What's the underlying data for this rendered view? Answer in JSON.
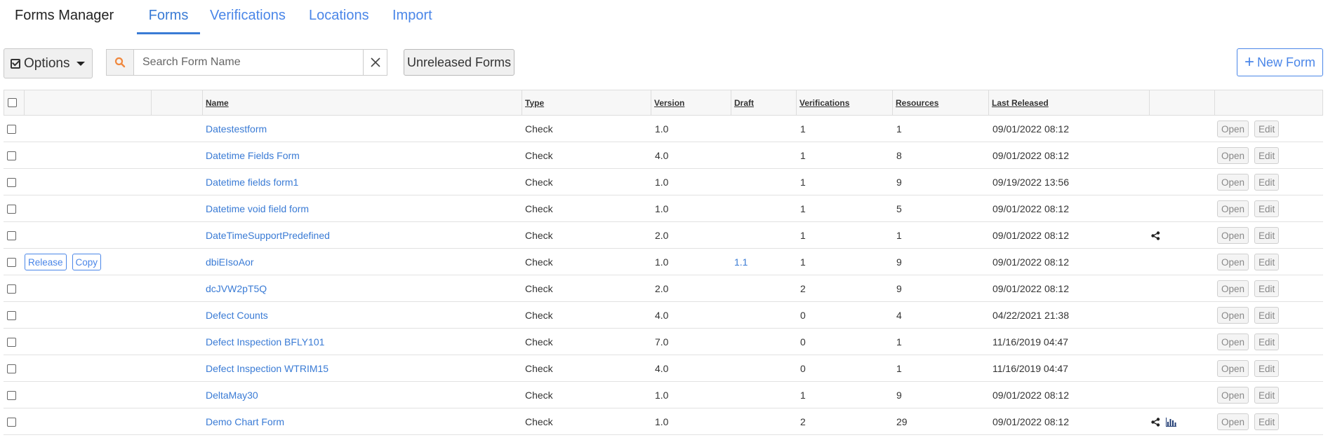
{
  "app": {
    "title": "Forms Manager"
  },
  "tabs": [
    {
      "label": "Forms",
      "active": true
    },
    {
      "label": "Verifications",
      "active": false
    },
    {
      "label": "Locations",
      "active": false
    },
    {
      "label": "Import",
      "active": false
    }
  ],
  "toolbar": {
    "options_label": "Options",
    "search_placeholder": "Search Form Name",
    "search_value": "",
    "unreleased_label": "Unreleased Forms",
    "new_form_label": "New Form"
  },
  "colors": {
    "accent": "#3a7bd5",
    "search_icon": "#f0883e"
  },
  "table": {
    "columns": [
      "Name",
      "Type",
      "Version",
      "Draft",
      "Verifications",
      "Resources",
      "Last Released"
    ],
    "rows": [
      {
        "name": "Datestestform",
        "type": "Check",
        "version": "1.0",
        "draft": "",
        "verifications": "1",
        "resources": "1",
        "last_released": "09/01/2022 08:12",
        "actions": [],
        "icons": [],
        "open": "Open",
        "edit": "Edit"
      },
      {
        "name": "Datetime Fields Form",
        "type": "Check",
        "version": "4.0",
        "draft": "",
        "verifications": "1",
        "resources": "8",
        "last_released": "09/01/2022 08:12",
        "actions": [],
        "icons": [],
        "open": "Open",
        "edit": "Edit"
      },
      {
        "name": "Datetime fields form1",
        "type": "Check",
        "version": "1.0",
        "draft": "",
        "verifications": "1",
        "resources": "9",
        "last_released": "09/19/2022 13:56",
        "actions": [],
        "icons": [],
        "open": "Open",
        "edit": "Edit"
      },
      {
        "name": "Datetime void field form",
        "type": "Check",
        "version": "1.0",
        "draft": "",
        "verifications": "1",
        "resources": "5",
        "last_released": "09/01/2022 08:12",
        "actions": [],
        "icons": [],
        "open": "Open",
        "edit": "Edit"
      },
      {
        "name": "DateTimeSupportPredefined",
        "type": "Check",
        "version": "2.0",
        "draft": "",
        "verifications": "1",
        "resources": "1",
        "last_released": "09/01/2022 08:12",
        "actions": [],
        "icons": [
          "share-icon"
        ],
        "open": "Open",
        "edit": "Edit"
      },
      {
        "name": "dbiEIsoAor",
        "type": "Check",
        "version": "1.0",
        "draft": "1.1",
        "verifications": "1",
        "resources": "9",
        "last_released": "09/01/2022 08:12",
        "actions": [
          "Release",
          "Copy"
        ],
        "icons": [],
        "open": "Open",
        "edit": "Edit"
      },
      {
        "name": "dcJVW2pT5Q",
        "type": "Check",
        "version": "2.0",
        "draft": "",
        "verifications": "2",
        "resources": "9",
        "last_released": "09/01/2022 08:12",
        "actions": [],
        "icons": [],
        "open": "Open",
        "edit": "Edit"
      },
      {
        "name": "Defect Counts",
        "type": "Check",
        "version": "4.0",
        "draft": "",
        "verifications": "0",
        "resources": "4",
        "last_released": "04/22/2021 21:38",
        "actions": [],
        "icons": [],
        "open": "Open",
        "edit": "Edit"
      },
      {
        "name": "Defect Inspection BFLY101",
        "type": "Check",
        "version": "7.0",
        "draft": "",
        "verifications": "0",
        "resources": "1",
        "last_released": "11/16/2019 04:47",
        "actions": [],
        "icons": [],
        "open": "Open",
        "edit": "Edit"
      },
      {
        "name": "Defect Inspection WTRIM15",
        "type": "Check",
        "version": "4.0",
        "draft": "",
        "verifications": "0",
        "resources": "1",
        "last_released": "11/16/2019 04:47",
        "actions": [],
        "icons": [],
        "open": "Open",
        "edit": "Edit"
      },
      {
        "name": "DeltaMay30",
        "type": "Check",
        "version": "1.0",
        "draft": "",
        "verifications": "1",
        "resources": "9",
        "last_released": "09/01/2022 08:12",
        "actions": [],
        "icons": [],
        "open": "Open",
        "edit": "Edit"
      },
      {
        "name": "Demo Chart Form",
        "type": "Check",
        "version": "1.0",
        "draft": "",
        "verifications": "2",
        "resources": "29",
        "last_released": "09/01/2022 08:12",
        "actions": [],
        "icons": [
          "share-icon",
          "bar-chart-icon"
        ],
        "open": "Open",
        "edit": "Edit"
      }
    ]
  }
}
